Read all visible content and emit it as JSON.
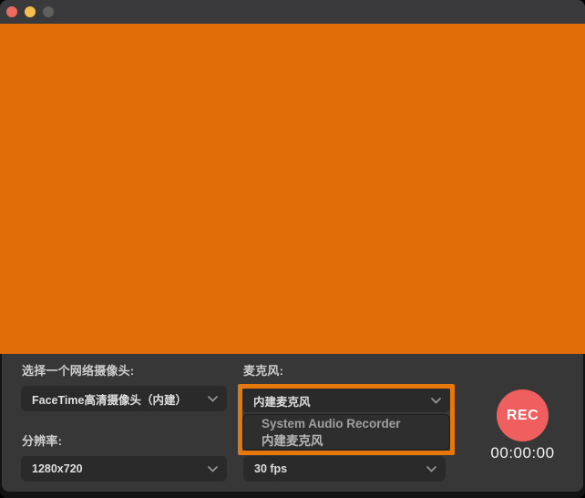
{
  "window": {
    "traffic_lights": {
      "close": "close-button",
      "minimize": "minimize-button",
      "zoom": "zoom-button-disabled"
    }
  },
  "preview": {
    "description": "webcam-preview-area"
  },
  "controls": {
    "webcam": {
      "label": "选择一个网络摄像头:",
      "value": "FaceTime高清摄像头（内建）"
    },
    "resolution": {
      "label": "分辨率:",
      "value": "1280x720"
    },
    "microphone": {
      "label": "麦克风:",
      "value": "内建麦克风",
      "options": [
        "System Audio Recorder",
        "内建麦克风"
      ]
    },
    "fps": {
      "value": "30 fps"
    },
    "record": {
      "label": "REC",
      "timer": "00:00:00"
    }
  },
  "colors": {
    "preview_orange": "#e06d07",
    "highlight_border_orange": "#e5770d",
    "record_red": "#ef5f5f",
    "panel_gray": "#373737",
    "titlebar_gray": "#3a3a3c",
    "select_bg": "#2a2a2b"
  }
}
